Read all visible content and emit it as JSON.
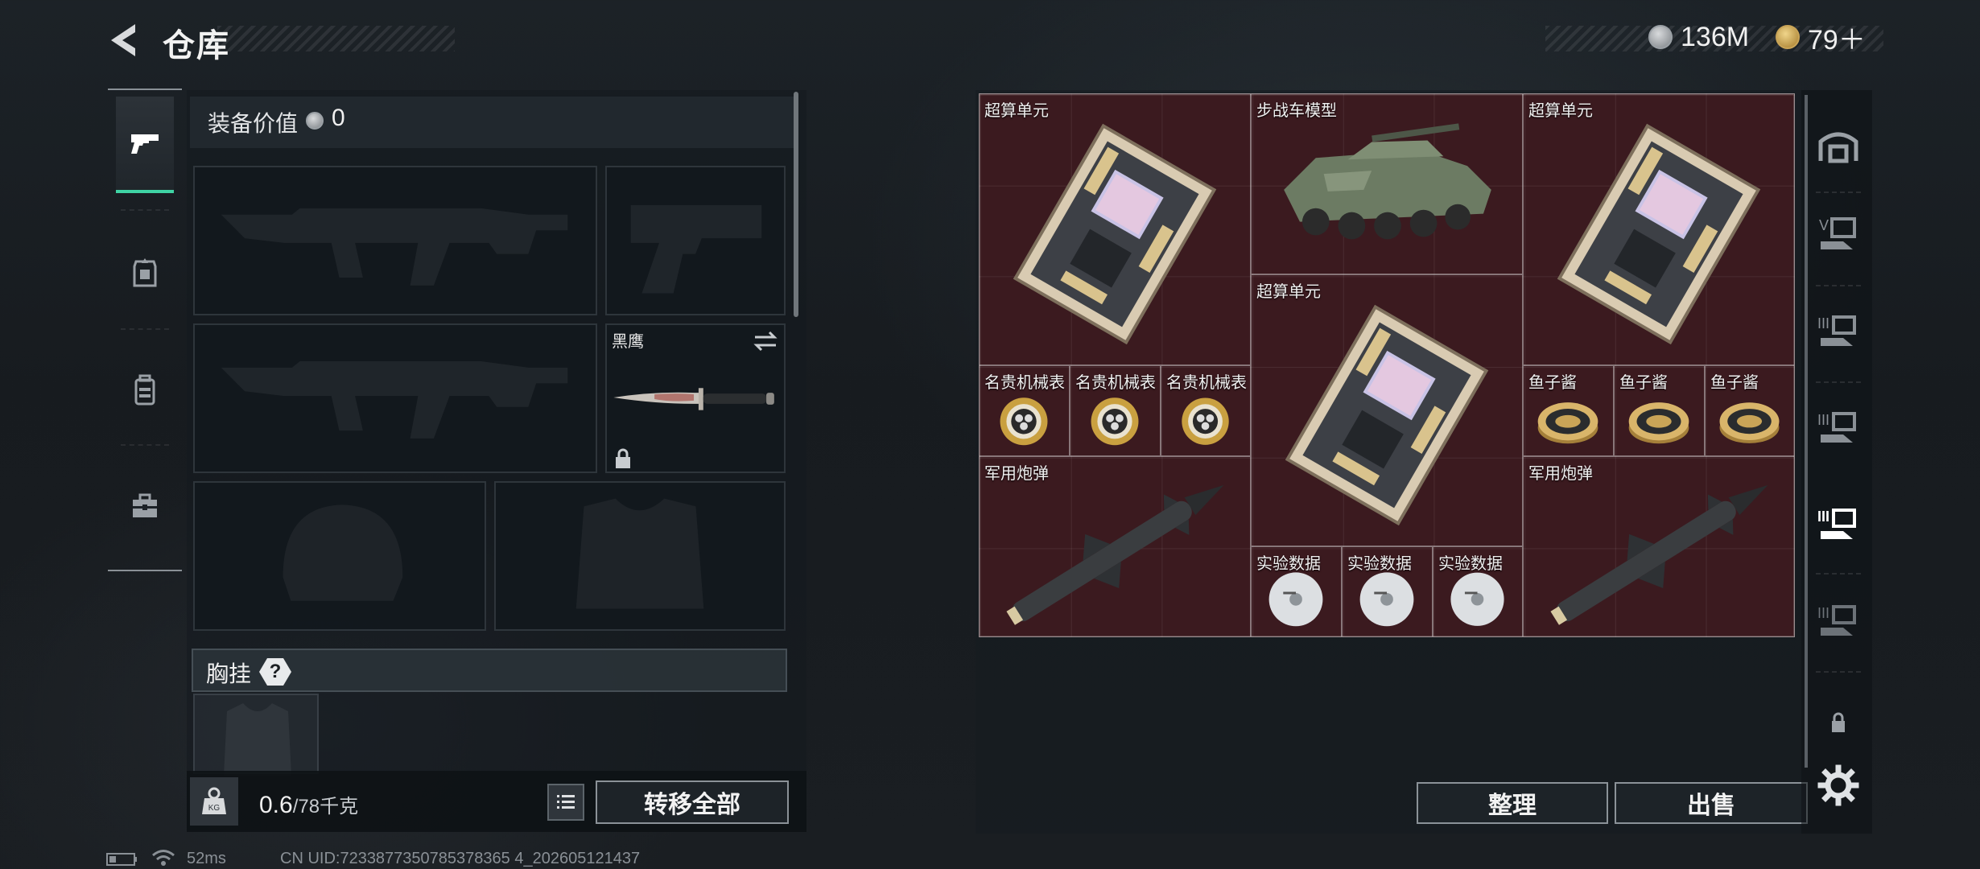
{
  "header": {
    "title": "仓库",
    "currency_silver": "136M",
    "currency_gold": "79＋"
  },
  "equipment": {
    "value_label": "装备价值",
    "value": "0",
    "knife_slot_label": "黑鹰",
    "chest_rig_label": "胸挂",
    "help_mark": "?"
  },
  "weight": {
    "current": "0.6",
    "max": "/78千克"
  },
  "buttons": {
    "transfer_all": "转移全部",
    "organize": "整理",
    "sell": "出售"
  },
  "stash_items": [
    {
      "name": "超算单元",
      "icon": "compute-unit"
    },
    {
      "name": "步战车模型",
      "icon": "ifv-model"
    },
    {
      "name": "超算单元",
      "icon": "compute-unit"
    },
    {
      "name": "超算单元",
      "icon": "compute-unit"
    },
    {
      "name": "名贵机械表",
      "icon": "luxury-watch"
    },
    {
      "name": "名贵机械表",
      "icon": "luxury-watch"
    },
    {
      "name": "名贵机械表",
      "icon": "luxury-watch"
    },
    {
      "name": "鱼子酱",
      "icon": "caviar-tin"
    },
    {
      "name": "鱼子酱",
      "icon": "caviar-tin"
    },
    {
      "name": "鱼子酱",
      "icon": "caviar-tin"
    },
    {
      "name": "军用炮弹",
      "icon": "military-shell"
    },
    {
      "name": "军用炮弹",
      "icon": "military-shell"
    },
    {
      "name": "实验数据",
      "icon": "data-disc"
    },
    {
      "name": "实验数据",
      "icon": "data-disc"
    },
    {
      "name": "实验数据",
      "icon": "data-disc"
    }
  ],
  "status": {
    "ping": "52ms",
    "uid": "CN UID:7233877350785378365 4_202605121437"
  },
  "colors": {
    "accent": "#3fd3a4",
    "stash_bg": "#3b1a1f"
  }
}
